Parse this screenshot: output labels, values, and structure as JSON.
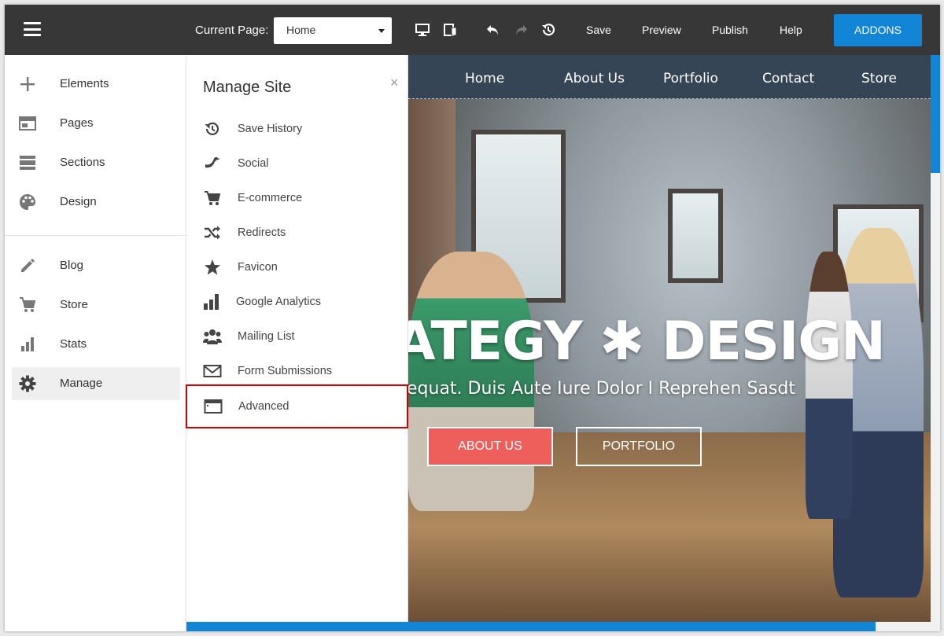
{
  "topbar": {
    "current_page_label": "Current Page:",
    "current_page_value": "Home",
    "save_label": "Save",
    "preview_label": "Preview",
    "publish_label": "Publish",
    "help_label": "Help",
    "addons_label": "ADDONS"
  },
  "sidebar": {
    "items": [
      {
        "label": "Elements",
        "icon": "plus-icon"
      },
      {
        "label": "Pages",
        "icon": "pages-icon"
      },
      {
        "label": "Sections",
        "icon": "sections-icon"
      },
      {
        "label": "Design",
        "icon": "palette-icon"
      },
      {
        "label": "Blog",
        "icon": "pencil-icon"
      },
      {
        "label": "Store",
        "icon": "cart-icon"
      },
      {
        "label": "Stats",
        "icon": "bar-chart-icon"
      },
      {
        "label": "Manage",
        "icon": "gear-icon",
        "active": true
      }
    ]
  },
  "panel": {
    "title": "Manage Site",
    "close": "×",
    "items": [
      {
        "label": "Save History",
        "icon": "history-icon"
      },
      {
        "label": "Social",
        "icon": "bird-icon"
      },
      {
        "label": "E-commerce",
        "icon": "cart-icon"
      },
      {
        "label": "Redirects",
        "icon": "shuffle-icon"
      },
      {
        "label": "Favicon",
        "icon": "star-icon"
      },
      {
        "label": "Google Analytics",
        "icon": "bar-chart-icon"
      },
      {
        "label": "Mailing List",
        "icon": "group-icon"
      },
      {
        "label": "Form Submissions",
        "icon": "envelope-icon"
      },
      {
        "label": "Advanced",
        "icon": "browser-window-icon",
        "highlighted": true
      }
    ]
  },
  "preview": {
    "nav": [
      "Home",
      "About Us",
      "Portfolio",
      "Contact",
      "Store"
    ],
    "headline": "ATEGY ✱ DESIGN",
    "subline": "equat. Duis Aute Iure Dolor I Reprehen Sasdt",
    "about_button": "ABOUT US",
    "portfolio_button": "PORTFOLIO"
  },
  "colors": {
    "topbar": "#373737",
    "accent": "#1385d6",
    "highlight_border": "#d40000",
    "nav_bg": "#364556",
    "cta": "#ee5f5b"
  }
}
